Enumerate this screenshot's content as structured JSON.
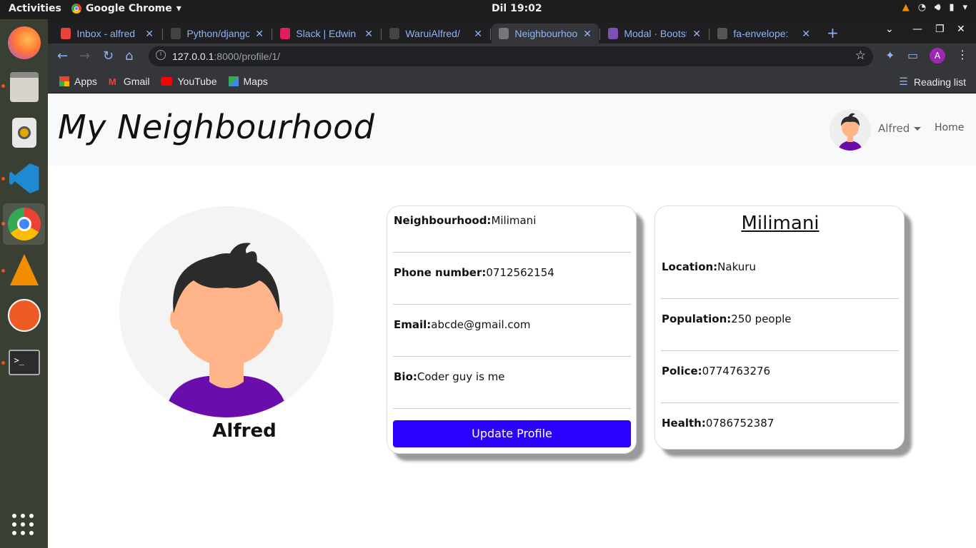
{
  "system": {
    "activities": "Activities",
    "app_name": "Google Chrome",
    "clock": "Dil 19:02"
  },
  "browser": {
    "tabs": [
      {
        "title": "Inbox - alfred",
        "icon": "gmail-icon",
        "color": "#ea4335"
      },
      {
        "title": "Python/django",
        "icon": "github-icon",
        "color": "#444"
      },
      {
        "title": "Slack | Edwin",
        "icon": "slack-icon",
        "color": "#e01e5a"
      },
      {
        "title": "WaruiAlfred/",
        "icon": "github-icon",
        "color": "#444"
      },
      {
        "title": "Neighbourhood",
        "icon": "globe-icon",
        "color": "#777"
      },
      {
        "title": "Modal · Bootstrap",
        "icon": "bootstrap-icon",
        "color": "#7952b3"
      },
      {
        "title": "fa-envelope:",
        "icon": "flag-icon",
        "color": "#555"
      }
    ],
    "active_tab": 4,
    "url_host": "127.0.0.1",
    "url_path": ":8000/profile/1/",
    "avatar_letter": "A",
    "bookmarks": [
      {
        "label": "Apps",
        "icon": "apps-grid-icon"
      },
      {
        "label": "Gmail",
        "icon": "gmail-icon"
      },
      {
        "label": "YouTube",
        "icon": "youtube-icon"
      },
      {
        "label": "Maps",
        "icon": "maps-icon"
      }
    ],
    "reading_list": "Reading list"
  },
  "navbar": {
    "brand": "My Neighbourhood",
    "user": "Alfred",
    "home": "Home"
  },
  "profile": {
    "name": "Alfred",
    "fields": [
      {
        "label": "Neighbourhood:",
        "value": "Milimani"
      },
      {
        "label": "Phone number:",
        "value": "0712562154"
      },
      {
        "label": "Email:",
        "value": "abcde@gmail.com"
      },
      {
        "label": "Bio:",
        "value": "Coder guy is me"
      }
    ],
    "update_button": "Update Profile"
  },
  "neighbourhood": {
    "title": "Milimani",
    "fields": [
      {
        "label": "Location:",
        "value": "Nakuru"
      },
      {
        "label": "Population:",
        "value": "250 people"
      },
      {
        "label": "Police:",
        "value": "0774763276"
      },
      {
        "label": "Health:",
        "value": "0786752387"
      }
    ]
  },
  "colors": {
    "accent_button": "#2a00ff",
    "shirt": "#6a0dad",
    "skin": "#ffb48a",
    "hair": "#2b2b2b"
  }
}
